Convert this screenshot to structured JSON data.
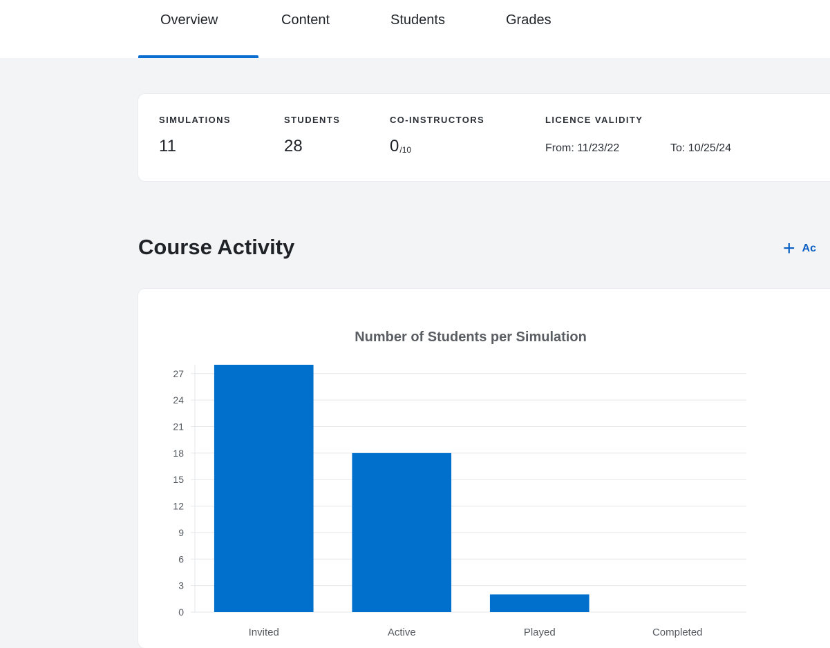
{
  "tabs": [
    {
      "label": "Overview",
      "active": true
    },
    {
      "label": "Content",
      "active": false
    },
    {
      "label": "Students",
      "active": false
    },
    {
      "label": "Grades",
      "active": false
    }
  ],
  "stats": {
    "simulations": {
      "label": "SIMULATIONS",
      "value": "11"
    },
    "students": {
      "label": "STUDENTS",
      "value": "28"
    },
    "co_instructors": {
      "label": "CO-INSTRUCTORS",
      "value": "0",
      "suffix": "/10"
    },
    "licence": {
      "label": "LICENCE VALIDITY",
      "from": "From: 11/23/22",
      "to": "To: 10/25/24"
    }
  },
  "section": {
    "title": "Course Activity",
    "add_label": "Ac"
  },
  "colors": {
    "accent": "#0a6fd0",
    "bar": "#0070cc"
  },
  "chart_data": {
    "type": "bar",
    "title": "Number of Students per Simulation",
    "categories": [
      "Invited",
      "Active",
      "Played",
      "Completed"
    ],
    "values": [
      28,
      18,
      2,
      0
    ],
    "ylim": [
      0,
      28
    ],
    "yticks": [
      0,
      3,
      6,
      9,
      12,
      15,
      18,
      21,
      24,
      27
    ],
    "grid": true
  }
}
